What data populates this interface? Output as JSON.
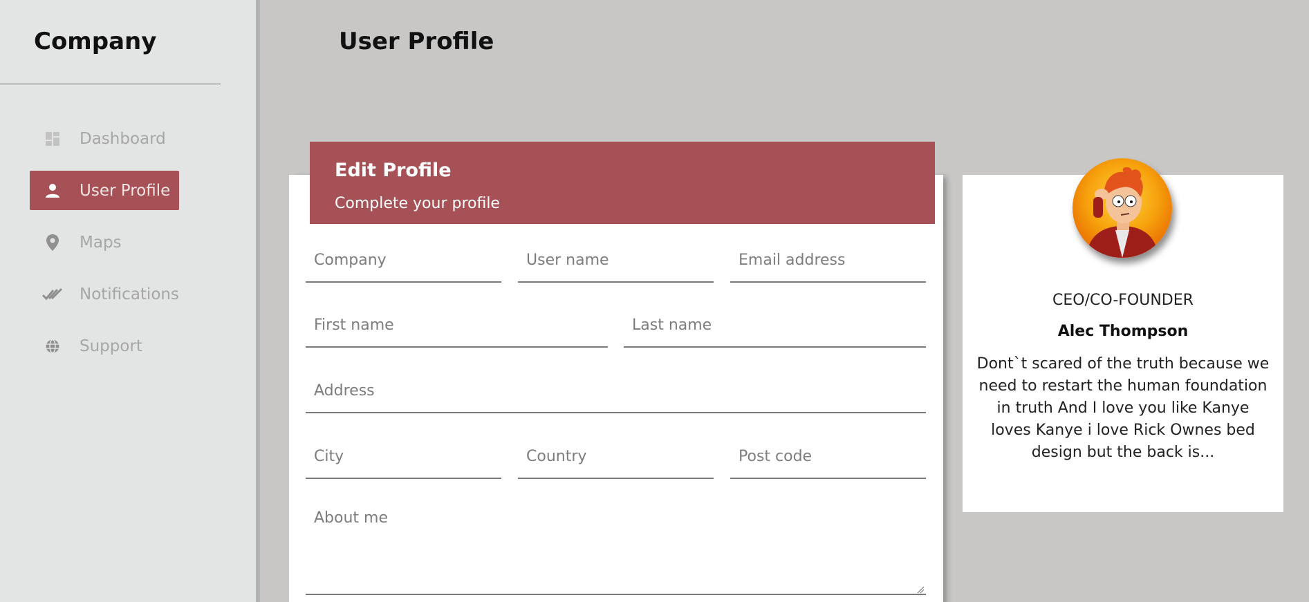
{
  "sidebar": {
    "brand": "Company",
    "items": [
      {
        "label": "Dashboard",
        "icon": "dashboard-icon",
        "active": false
      },
      {
        "label": "User Profile",
        "icon": "person-icon",
        "active": true
      },
      {
        "label": "Maps",
        "icon": "location-pin-icon",
        "active": false
      },
      {
        "label": "Notifications",
        "icon": "double-check-icon",
        "active": false
      },
      {
        "label": "Support",
        "icon": "globe-icon",
        "active": false
      }
    ]
  },
  "header": {
    "title": "User Profile"
  },
  "form": {
    "title": "Edit Profile",
    "subtitle": "Complete your profile",
    "fields": {
      "company": {
        "placeholder": "Company",
        "value": ""
      },
      "username": {
        "placeholder": "User name",
        "value": ""
      },
      "email": {
        "placeholder": "Email address",
        "value": ""
      },
      "first_name": {
        "placeholder": "First name",
        "value": ""
      },
      "last_name": {
        "placeholder": "Last name",
        "value": ""
      },
      "address": {
        "placeholder": "Address",
        "value": ""
      },
      "city": {
        "placeholder": "City",
        "value": ""
      },
      "country": {
        "placeholder": "Country",
        "value": ""
      },
      "post_code": {
        "placeholder": "Post code",
        "value": ""
      },
      "about": {
        "placeholder": "About me",
        "value": ""
      }
    }
  },
  "profile": {
    "role": "CEO/CO-FOUNDER",
    "name": "Alec Thompson",
    "bio": "Dont`t scared of the truth because we need to restart the human foundation in truth And I love you like Kanye loves Kanye i love Rick Ownes bed design but the back is..."
  },
  "colors": {
    "accent": "#a65156",
    "sidebar_bg": "#e3e4e4",
    "page_bg": "#c8c7c6"
  }
}
